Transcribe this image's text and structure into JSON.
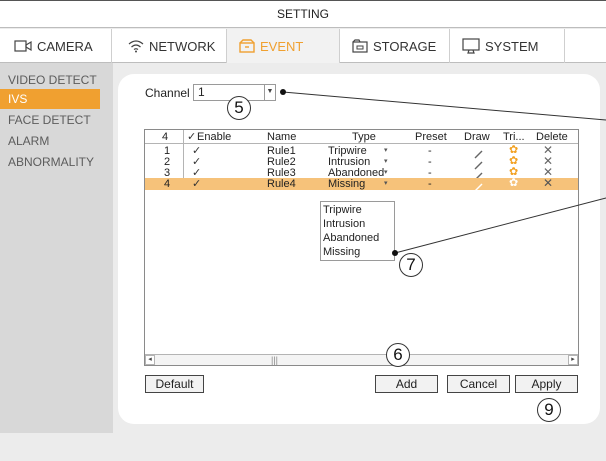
{
  "window": {
    "title": "SETTING"
  },
  "tabs": [
    {
      "label": "CAMERA",
      "icon": "camera-icon"
    },
    {
      "label": "NETWORK",
      "icon": "wifi-icon"
    },
    {
      "label": "EVENT",
      "icon": "event-box-icon",
      "active": true
    },
    {
      "label": "STORAGE",
      "icon": "storage-icon"
    },
    {
      "label": "SYSTEM",
      "icon": "monitor-icon"
    }
  ],
  "sidebar": {
    "items": [
      {
        "label": "VIDEO DETECT"
      },
      {
        "label": "IVS",
        "active": true
      },
      {
        "label": "FACE DETECT"
      },
      {
        "label": "ALARM"
      },
      {
        "label": "ABNORMALITY"
      }
    ]
  },
  "channel": {
    "label": "Channel",
    "value": "1"
  },
  "table": {
    "count": "4",
    "headers": {
      "enable": "Enable",
      "name": "Name",
      "type": "Type",
      "preset": "Preset",
      "draw": "Draw",
      "trigger": "Tri...",
      "delete": "Delete"
    },
    "rows": [
      {
        "num": "1",
        "enabled": "✓",
        "name": "Rule1",
        "type": "Tripwire",
        "preset": "-"
      },
      {
        "num": "2",
        "enabled": "✓",
        "name": "Rule2",
        "type": "Intrusion",
        "preset": "-"
      },
      {
        "num": "3",
        "enabled": "✓",
        "name": "Rule3",
        "type": "Abandoned",
        "preset": "-"
      },
      {
        "num": "4",
        "enabled": "✓",
        "name": "Rule4",
        "type": "Missing",
        "preset": "-",
        "selected": true
      }
    ],
    "type_options": [
      "Tripwire",
      "Intrusion",
      "Abandoned",
      "Missing"
    ]
  },
  "buttons": {
    "default": "Default",
    "add": "Add",
    "cancel": "Cancel",
    "apply": "Apply"
  },
  "callouts": {
    "c5": "5",
    "c6": "6",
    "c7": "7",
    "c9": "9"
  },
  "colors": {
    "accent": "#f0a030",
    "selected_row": "#f6c27a",
    "sidebar_bg": "#d8d8d8"
  }
}
